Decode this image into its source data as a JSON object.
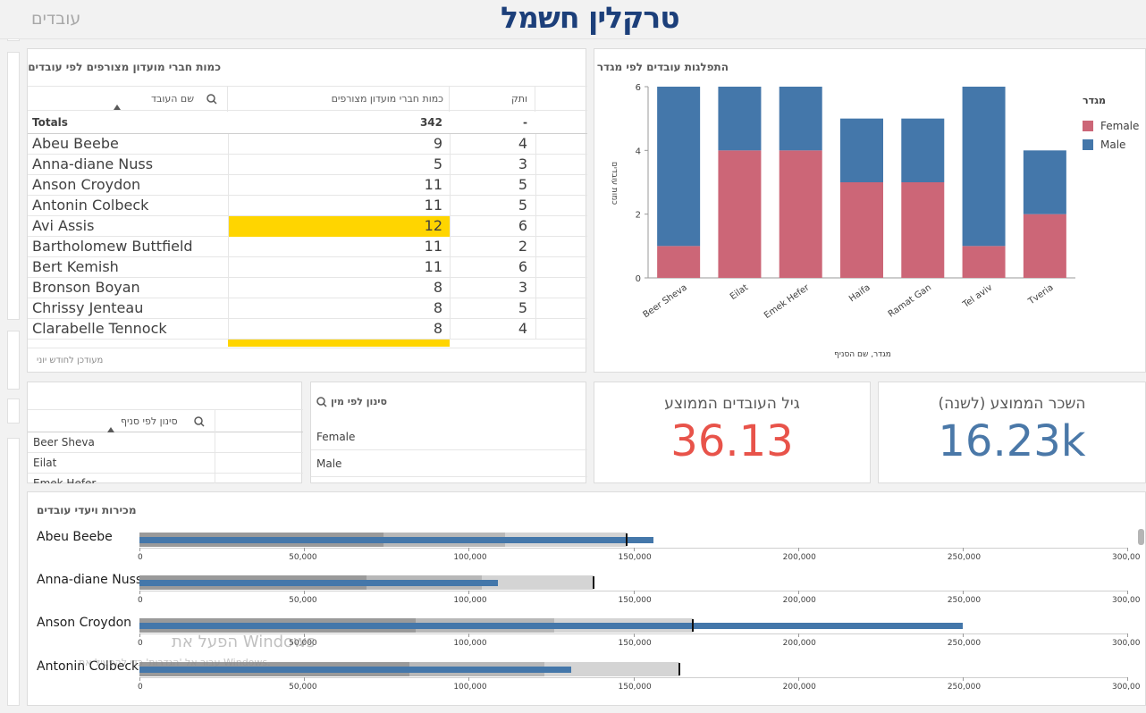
{
  "sheet_title": "עובדים",
  "logo_text": "טרקלין חשמל",
  "members_table": {
    "title": "כמות חברי מועדון מצורפים לפי עובדים",
    "col_name": "שם העובד",
    "col_count": "כמות חברי מועדון מצורפים",
    "col_seniority": "ותק",
    "totals_label": "Totals",
    "totals_count": "342",
    "totals_seniority": "-",
    "rows": [
      {
        "name": "Abeu Beebe",
        "count": "9",
        "seniority": "4",
        "highlight": false
      },
      {
        "name": "Anna-diane Nuss",
        "count": "5",
        "seniority": "3",
        "highlight": false
      },
      {
        "name": "Anson Croydon",
        "count": "11",
        "seniority": "5",
        "highlight": false
      },
      {
        "name": "Antonin Colbeck",
        "count": "11",
        "seniority": "5",
        "highlight": false
      },
      {
        "name": "Avi Assis",
        "count": "12",
        "seniority": "6",
        "highlight": true
      },
      {
        "name": "Bartholomew Buttfield",
        "count": "11",
        "seniority": "2",
        "highlight": false
      },
      {
        "name": "Bert Kemish",
        "count": "11",
        "seniority": "6",
        "highlight": false
      },
      {
        "name": "Bronson Boyan",
        "count": "8",
        "seniority": "3",
        "highlight": false
      },
      {
        "name": "Chrissy Jenteau",
        "count": "8",
        "seniority": "5",
        "highlight": false
      },
      {
        "name": "Clarabelle Tennock",
        "count": "8",
        "seniority": "4",
        "highlight": false
      }
    ],
    "footer": "מעודכן לחודש יוני"
  },
  "gender_chart": {
    "title": "התפלגות עובדים לפי מגדר",
    "legend_title": "מגדר",
    "xlabel": "מגדר, שם הסניף",
    "ylabel": "כמות עובדים",
    "colors": {
      "female": "#cc6677",
      "male": "#4477aa"
    }
  },
  "chart_data": {
    "type": "bar",
    "stacked": true,
    "categories": [
      "Beer Sheva",
      "Eilat",
      "Emek Hefer",
      "Haifa",
      "Ramat Gan",
      "Tel aviv",
      "Tveria"
    ],
    "series": [
      {
        "name": "Female",
        "values": [
          1,
          4,
          4,
          3,
          3,
          1,
          2
        ]
      },
      {
        "name": "Male",
        "values": [
          5,
          2,
          2,
          2,
          2,
          5,
          2
        ]
      }
    ],
    "ylim": [
      0,
      6
    ],
    "yticks": [
      "0",
      "2",
      "4",
      "6"
    ],
    "legend_position": "right"
  },
  "branch_filter": {
    "header": "סינון לפי סניף",
    "items": [
      "Beer Sheva",
      "Eilat",
      "Emek Hefer"
    ]
  },
  "gender_filter": {
    "header": "סינון לפי מין",
    "items": [
      "Female",
      "Male"
    ]
  },
  "kpi_age": {
    "title": "גיל העובדים הממוצע",
    "value": "36.13",
    "color": "#e8534a"
  },
  "kpi_salary": {
    "title": "השכר הממוצע (לשנה)",
    "value": "16.23k",
    "color": "#4a78a8"
  },
  "sales_targets": {
    "title": "מכירות ויעדי עובדים",
    "axis_ticks": [
      "0",
      "50,000",
      "100,000",
      "150,000",
      "200,000",
      "250,000",
      "300,00"
    ],
    "axis_max": 300000,
    "rows": [
      {
        "name": "Abeu Beebe",
        "value": 156000,
        "target": 148000,
        "range1": 74000,
        "range2": 111000,
        "range3": 148000
      },
      {
        "name": "Anna-diane Nuss",
        "value": 109000,
        "target": 138000,
        "range1": 69000,
        "range2": 104000,
        "range3": 138000
      },
      {
        "name": "Anson Croydon",
        "value": 250000,
        "target": 168000,
        "range1": 84000,
        "range2": 126000,
        "range3": 168000
      },
      {
        "name": "Antonin Colbeck",
        "value": 131000,
        "target": 164000,
        "range1": 82000,
        "range2": 123000,
        "range3": 164000
      }
    ]
  },
  "watermark": {
    "line1": "הפעל את Windows",
    "line2": "עבור אל 'הגדרות' כדי להפעיל את Windows."
  }
}
